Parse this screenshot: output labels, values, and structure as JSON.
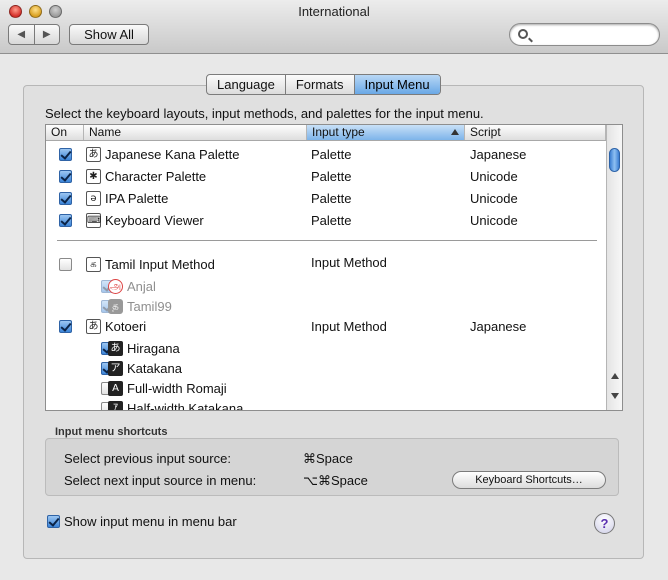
{
  "window": {
    "title": "International"
  },
  "toolbar": {
    "back_label": "◀",
    "forward_label": "▶",
    "show_all_label": "Show All",
    "search_placeholder": ""
  },
  "tabs": [
    {
      "label": "Language",
      "active": false
    },
    {
      "label": "Formats",
      "active": false
    },
    {
      "label": "Input Menu",
      "active": true
    }
  ],
  "instructions": "Select the keyboard layouts, input methods, and palettes for the input menu.",
  "table": {
    "columns": {
      "on": "On",
      "name": "Name",
      "input_type": "Input type",
      "script": "Script"
    },
    "rows": [
      {
        "checked": true,
        "icon": "あ",
        "name": "Japanese Kana Palette",
        "type": "Palette",
        "script": "Japanese"
      },
      {
        "checked": true,
        "icon": "✱",
        "name": "Character Palette",
        "type": "Palette",
        "script": "Unicode"
      },
      {
        "checked": true,
        "icon": "ə",
        "name": "IPA Palette",
        "type": "Palette",
        "script": "Unicode"
      },
      {
        "checked": true,
        "icon": "⌨",
        "name": "Keyboard Viewer",
        "type": "Palette",
        "script": "Unicode"
      },
      {
        "checked": false,
        "icon": "க",
        "name": "Tamil Input Method",
        "type": "Input Method",
        "script": ""
      },
      {
        "checked": true,
        "icon": "அ",
        "name": "Anjal",
        "type": "",
        "script": "",
        "sub": true,
        "disabled": true
      },
      {
        "checked": true,
        "icon": "த",
        "name": "Tamil99",
        "type": "",
        "script": "",
        "sub": true,
        "disabled": true
      },
      {
        "checked": true,
        "icon": "あ",
        "name": "Kotoeri",
        "type": "Input Method",
        "script": "Japanese"
      },
      {
        "checked": true,
        "icon": "あ",
        "name": "Hiragana",
        "type": "",
        "script": "",
        "sub": true
      },
      {
        "checked": true,
        "icon": "ア",
        "name": "Katakana",
        "type": "",
        "script": "",
        "sub": true
      },
      {
        "checked": false,
        "icon": "A",
        "name": "Full-width Romaji",
        "type": "",
        "script": "",
        "sub": true
      },
      {
        "checked": false,
        "icon": "ｱ",
        "name": "Half-width Katakana",
        "type": "",
        "script": "",
        "sub": true
      }
    ]
  },
  "shortcuts": {
    "section_label": "Input menu shortcuts",
    "prev_label": "Select previous input source:",
    "prev_key": "⌘Space",
    "next_label": "Select next input source in menu:",
    "next_key": "⌥⌘Space",
    "button_label": "Keyboard Shortcuts…"
  },
  "show_menu": {
    "checked": true,
    "label": "Show input menu in menu bar"
  },
  "help_label": "?"
}
